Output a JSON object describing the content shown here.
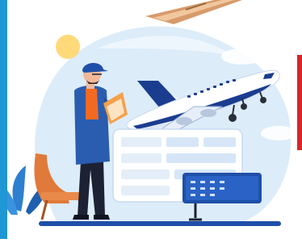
{
  "illustration": {
    "subject": "airport-travel-booking",
    "colors": {
      "accent_left": "#1f97d4",
      "accent_right": "#d7262c",
      "sky": "#dcecf9",
      "plane_body": "#ffffff",
      "plane_blue": "#1b3d8f",
      "jacket": "#2a5db0",
      "shirt": "#f26a21",
      "pants": "#1c2233",
      "chair": "#e07a3a",
      "sun": "#ffd97a",
      "clipboard": "#f5a04a"
    },
    "icons": [
      "airplane-icon",
      "sun-icon",
      "clipboard-icon",
      "chair-icon",
      "plant-icon",
      "departure-board-icon",
      "form-panel-icon"
    ]
  }
}
